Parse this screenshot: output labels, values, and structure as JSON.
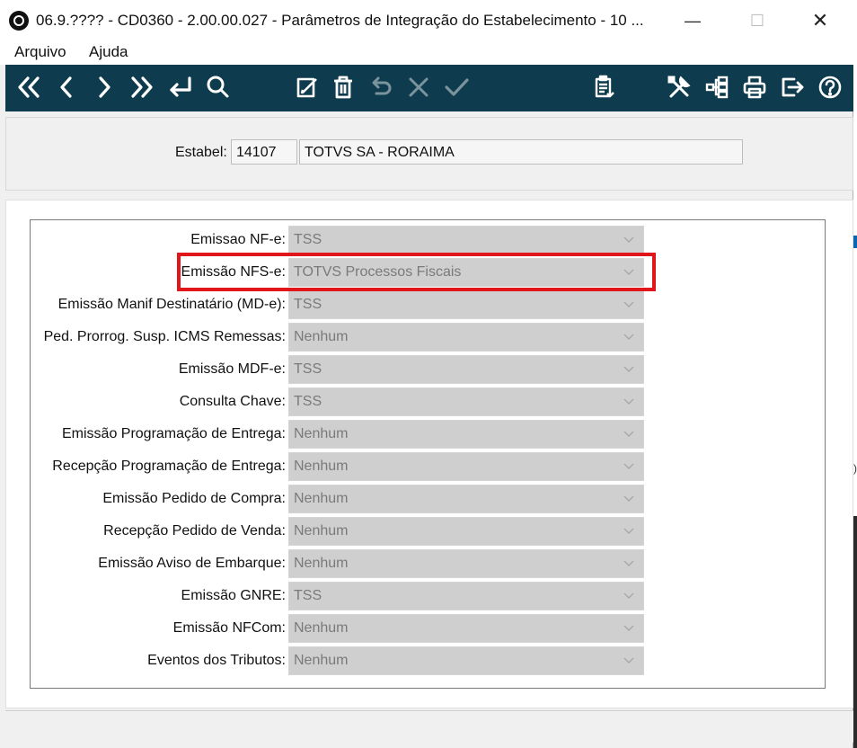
{
  "window": {
    "title": "06.9.???? - CD0360 - 2.00.00.027 - Parâmetros de Integração do Estabelecimento - 10 ...",
    "minimize": "—",
    "maximize": "☐",
    "close": "✕"
  },
  "menu": [
    "Arquivo",
    "Ajuda"
  ],
  "toolbar": {
    "icons": [
      "first-record-icon",
      "previous-record-icon",
      "next-record-icon",
      "last-record-icon",
      "goto-icon",
      "search-icon",
      "edit-icon",
      "delete-icon",
      "undo-icon",
      "cancel-icon",
      "confirm-icon",
      "clipboard-icon",
      "tools-icon",
      "hierarchy-icon",
      "print-icon",
      "exit-icon",
      "help-icon"
    ],
    "color": "#0e3b4d"
  },
  "header": {
    "estabel_label": "Estabel:",
    "estabel_code": "14107",
    "estabel_name": "TOTVS SA - RORAIMA"
  },
  "fields": [
    {
      "label": "Emissao NF-e:",
      "value": "TSS"
    },
    {
      "label": "Emissão NFS-e:",
      "value": "TOTVS Processos Fiscais"
    },
    {
      "label": "Emissão Manif Destinatário (MD-e):",
      "value": "TSS"
    },
    {
      "label": "Ped. Prorrog. Susp. ICMS Remessas:",
      "value": "Nenhum"
    },
    {
      "label": "Emissão MDF-e:",
      "value": "TSS"
    },
    {
      "label": "Consulta Chave:",
      "value": "TSS"
    },
    {
      "label": "Emissão Programação de Entrega:",
      "value": "Nenhum"
    },
    {
      "label": "Recepção Programação de Entrega:",
      "value": "Nenhum"
    },
    {
      "label": "Emissão Pedido de Compra:",
      "value": "Nenhum"
    },
    {
      "label": "Recepção Pedido de Venda:",
      "value": "Nenhum"
    },
    {
      "label": "Emissão Aviso de Embarque:",
      "value": "Nenhum"
    },
    {
      "label": "Emissão GNRE:",
      "value": "TSS"
    },
    {
      "label": "Emissão NFCom:",
      "value": "Nenhum"
    },
    {
      "label": "Eventos dos Tributos:",
      "value": "Nenhum"
    }
  ],
  "highlight_color": "#e0161b",
  "edge_glyph": ")"
}
